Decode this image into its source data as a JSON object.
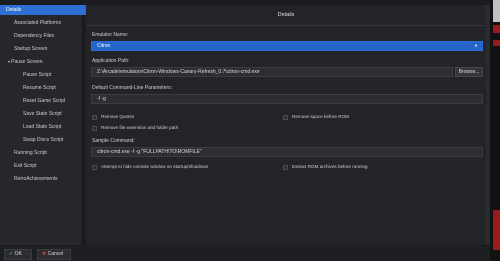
{
  "sidebar": {
    "items": [
      {
        "label": "Details"
      },
      {
        "label": "Associated Platforms"
      },
      {
        "label": "Dependency Files"
      },
      {
        "label": "Startup Screen"
      },
      {
        "label": "Pause Screen"
      },
      {
        "label": "Pause Script"
      },
      {
        "label": "Resume Script"
      },
      {
        "label": "Reset Game Script"
      },
      {
        "label": "Save State Script"
      },
      {
        "label": "Load State Script"
      },
      {
        "label": "Swap Discs Script"
      },
      {
        "label": "Running Script"
      },
      {
        "label": "Exit Script"
      },
      {
        "label": "RetroAchievements"
      }
    ]
  },
  "panel": {
    "title": "Details",
    "emulator_name_label": "Emulator Name:",
    "emulator_name_value": "Citron",
    "application_path_label": "Application Path:",
    "application_path_value": "Z:\\Arcade\\emulators\\Citron-Windows-Canary-Refresh_0.7\\citron-cmd.exe",
    "browse_label": "Browse...",
    "default_params_label": "Default Command-Line Parameters:",
    "default_params_value": "-f -g",
    "checkboxes": {
      "remove_quotes": "Remove Quotes",
      "remove_space_before_rom": "Remove space before ROM",
      "remove_file_extension": "Remove file extension and folder path",
      "hide_console": "Attempt to hide console window on startup/shutdown",
      "extract_rom": "Extract ROM archives before running"
    },
    "sample_command_label": "Sample Command:",
    "sample_command_value": "citron-cmd.exe -f -g \"FULLPATH\\TO\\ROMFILE\""
  },
  "footer": {
    "ok_label": "OK",
    "cancel_label": "Cancel"
  },
  "colors": {
    "accent": "#2f6fd3",
    "ok_icon": "#3cb04a",
    "cancel_icon": "#d23a3a"
  },
  "icons": [
    "chevron-down-icon",
    "expand-arrow-icon",
    "checkmark-icon",
    "cross-icon"
  ]
}
